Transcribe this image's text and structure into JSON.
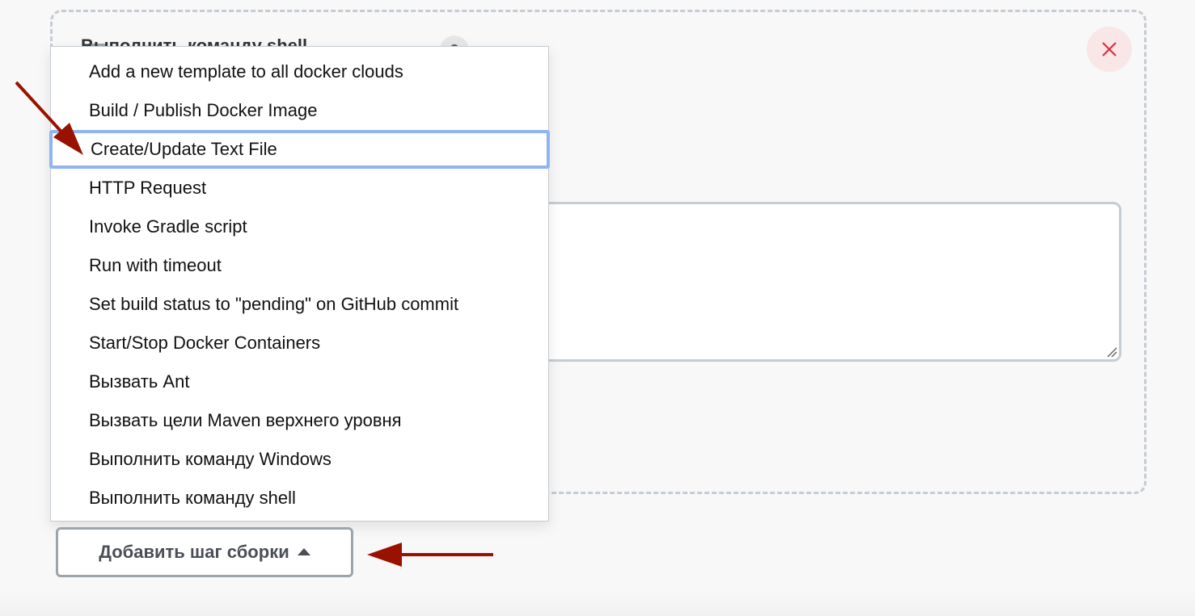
{
  "step_card": {
    "header_partial": "Выполнить команду shell",
    "help_icon": "help-icon",
    "close_icon": "close-icon",
    "close_color": "#e0303c",
    "textarea_value": ""
  },
  "dropdown": {
    "items": [
      {
        "label": "Add a new template to all docker clouds",
        "focused": false
      },
      {
        "label": "Build / Publish Docker Image",
        "focused": false
      },
      {
        "label": "Create/Update Text File",
        "focused": true
      },
      {
        "label": "HTTP Request",
        "focused": false
      },
      {
        "label": "Invoke Gradle script",
        "focused": false
      },
      {
        "label": "Run with timeout",
        "focused": false
      },
      {
        "label": "Set build status to \"pending\" on GitHub commit",
        "focused": false
      },
      {
        "label": "Start/Stop Docker Containers",
        "focused": false
      },
      {
        "label": "Вызвать Ant",
        "focused": false
      },
      {
        "label": "Вызвать цели Maven верхнего уровня",
        "focused": false
      },
      {
        "label": "Выполнить команду Windows",
        "focused": false
      },
      {
        "label": "Выполнить команду shell",
        "focused": false
      }
    ],
    "focus_color": "#8fb4f5"
  },
  "add_step_button": {
    "label": "Добавить шаг сборки",
    "icon": "caret-up-icon"
  },
  "annotations": {
    "arrow_color": "#991100",
    "arrows": [
      "arrow-to-create-update-text-file",
      "arrow-to-add-build-step-button"
    ]
  }
}
